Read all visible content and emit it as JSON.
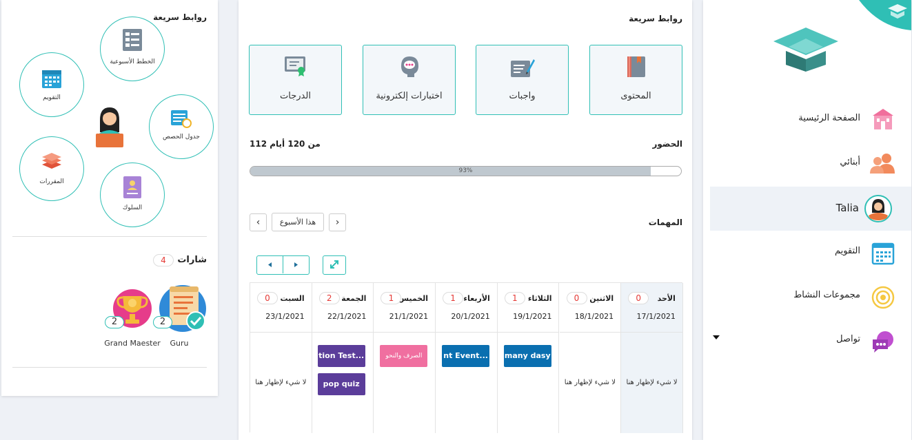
{
  "left_panel": {
    "quick_links_title": "روابط سريعة",
    "quick_links": [
      {
        "label": "الخطط الأسبوعية",
        "icon": "weekly-plan-icon"
      },
      {
        "label": "التقويم",
        "icon": "calendar-icon"
      },
      {
        "label": "جدول الحصص",
        "icon": "schedule-icon"
      },
      {
        "label": "المقررات",
        "icon": "books-icon"
      },
      {
        "label": "السلوك",
        "icon": "behavior-icon"
      }
    ],
    "badges_title": "شارات",
    "badges_count": "4",
    "badges": [
      {
        "name": "Guru",
        "count": "2",
        "icon": "scroll-check-icon"
      },
      {
        "name": "Grand Maester",
        "count": "2",
        "icon": "trophy-icon"
      }
    ]
  },
  "main": {
    "quick_links_title": "روابط سريعة",
    "quick_boxes": [
      {
        "label": "المحتوى",
        "icon": "book-icon"
      },
      {
        "label": "واجبات",
        "icon": "homework-icon"
      },
      {
        "label": "اختبارات إلكترونية",
        "icon": "chat-head-icon"
      },
      {
        "label": "الدرجات",
        "icon": "certificate-icon"
      }
    ],
    "attendance_label": "الحضور",
    "attendance_value": "112 من 120 أيام",
    "attendance_progress": 0.93,
    "attendance_percent_text": "93%",
    "tasks_label": "المهمات",
    "week_label": "هذا الأسبوع",
    "prev_symbol": "‹",
    "next_symbol": "›",
    "days": [
      {
        "name": "الأحد",
        "count": "0",
        "date": "17/1/2021",
        "today": true,
        "empty_text": "لا شيء لإظهار هنا"
      },
      {
        "name": "الاثنين",
        "count": "0",
        "date": "18/1/2021",
        "empty_text": "لا شيء لإظهار هنا"
      },
      {
        "name": "الثلاثاء",
        "count": "1",
        "date": "19/1/2021"
      },
      {
        "name": "الأربعاء",
        "count": "1",
        "date": "20/1/2021"
      },
      {
        "name": "الخميس",
        "count": "1",
        "date": "21/1/2021"
      },
      {
        "name": "الجمعة",
        "count": "2",
        "date": "22/1/2021"
      },
      {
        "name": "السبت",
        "count": "0",
        "date": "23/1/2021",
        "empty_text": "لا شيء لإظهار هنا"
      }
    ],
    "events": [
      {
        "label": "many dasy",
        "color": "#0a6fb0"
      },
      {
        "label": "nt Event...",
        "color": "#0a6fb0"
      },
      {
        "label": "الصرف والنحو",
        "color": "#f06fa0"
      },
      {
        "label": "tion Test...",
        "color": "#5b3d9a"
      },
      {
        "label": "pop quiz",
        "color": "#5b3d9a"
      }
    ]
  },
  "sidebar": {
    "items": [
      {
        "label": "الصفحة الرئيسية",
        "icon": "school-icon"
      },
      {
        "label": "أبنائي",
        "icon": "children-icon"
      },
      {
        "label": "Talia",
        "icon": "avatar-icon",
        "active": true
      },
      {
        "label": "التقويم",
        "icon": "calendar-icon"
      },
      {
        "label": "مجموعات النشاط",
        "icon": "target-icon"
      },
      {
        "label": "تواصل",
        "icon": "chat-icon",
        "dropdown": true
      }
    ]
  },
  "colors": {
    "accent": "#2fbfb5",
    "danger": "#e53935",
    "event_blue": "#0a6fb0",
    "event_pink": "#f06fa0",
    "event_purple": "#5b3d9a"
  }
}
